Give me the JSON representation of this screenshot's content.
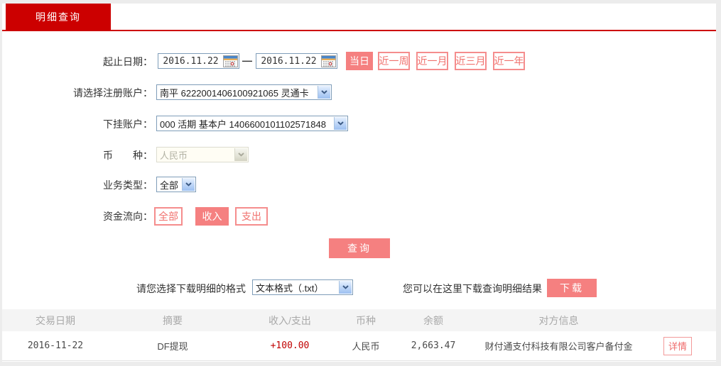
{
  "tab": {
    "label": "明细查询"
  },
  "form": {
    "date_range": {
      "label": "起止日期：",
      "start_value": "2016.11.22",
      "end_value": "2016.11.22",
      "separator": "—",
      "quick_buttons": [
        {
          "label": "当日",
          "active": true
        },
        {
          "label": "近一周",
          "active": false
        },
        {
          "label": "近一月",
          "active": false
        },
        {
          "label": "近三月",
          "active": false
        },
        {
          "label": "近一年",
          "active": false
        }
      ]
    },
    "register_account": {
      "label": "请选择注册账户：",
      "value": "南平 6222001406100921065 灵通卡"
    },
    "sub_account": {
      "label": "下挂账户：",
      "value": "000 活期 基本户 1406600101102571848"
    },
    "currency": {
      "label": "币　　种：",
      "value": "人民币",
      "disabled": true
    },
    "business_type": {
      "label": "业务类型：",
      "value": "全部"
    },
    "fund_flow": {
      "label": "资金流向：",
      "options": [
        {
          "label": "全部",
          "active": false
        },
        {
          "label": "收入",
          "active": true
        },
        {
          "label": "支出",
          "active": false
        }
      ]
    },
    "query_button": "查询"
  },
  "download": {
    "format_label": "请您选择下载明细的格式",
    "format_value": "文本格式（.txt）",
    "hint": "您可以在这里下载查询明细结果",
    "button": "下载"
  },
  "table": {
    "headers": [
      "交易日期",
      "摘要",
      "收入/支出",
      "币种",
      "余额",
      "对方信息"
    ],
    "rows": [
      {
        "date": "2016-11-22",
        "summary": "DF提现",
        "amount": "+100.00",
        "currency": "人民币",
        "balance": "2,663.47",
        "counterparty": "财付通支付科技有限公司客户备付金",
        "detail_button": "详情"
      }
    ]
  },
  "icons": {
    "date_picker": "calendar-icon",
    "select_arrow": "chevron-down-icon"
  },
  "colors": {
    "brand_red": "#cc0000",
    "button_salmon": "#f58080",
    "button_outline_text": "#f0716d",
    "amount_red": "#c00000",
    "table_header_bg": "#f4f4f4"
  }
}
